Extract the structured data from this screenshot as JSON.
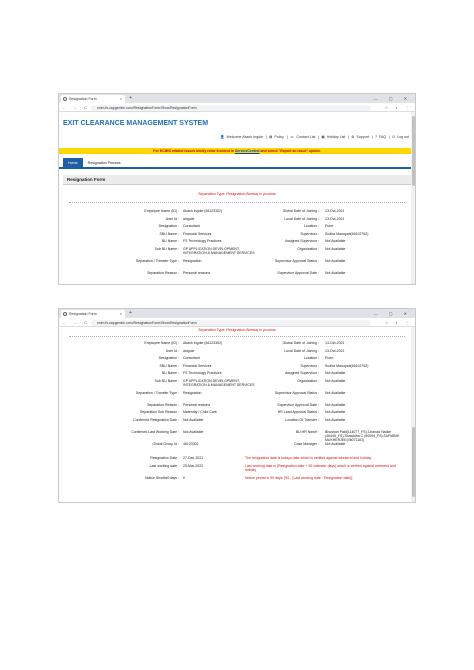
{
  "browser": {
    "tab_title": "Resignation Form",
    "tab_close": "×",
    "new_tab": "+",
    "window_controls": "— ▢ ✕",
    "nav_buttons": "← → C ⌂",
    "url": "ecim.fs.capgemini.com/ResignationForm/ShowResignationForm",
    "addr_icons": "☆ ◐ ⋮"
  },
  "app": {
    "title": "EXIT CLEARANCE MANAGEMENT SYSTEM",
    "welcome": "Welcome Akash Ingole",
    "policy": "Policy",
    "contact_list": "Contact List",
    "holiday_list": "Holiday List",
    "support": "Support",
    "faq": "FAQ",
    "logout": "Log out",
    "banner_pre": "For ECIMS related issues kindly raise incident in",
    "banner_link": "ServiceCentral",
    "banner_post": "and select \"Report an issue\" option.",
    "nav_home": "Home",
    "nav_process": "Resignation Process",
    "section_title": "Resignation Form",
    "separation_type": "Separation Type: Resignation Already in process"
  },
  "form1": [
    [
      "Employee Name (ID) :",
      "Akash Ingole (46123302)",
      "Global Date of Joining :",
      "13-Oct-2021"
    ],
    [
      "User Id :",
      "aingole",
      "Local Date of Joining :",
      "13-Oct-2021"
    ],
    [
      "Designation :",
      "Consultant",
      "Location :",
      "Pune"
    ],
    [
      "SBU Name :",
      "Financial Services",
      "Supervisor :",
      "Sudha Manupati(46102762)"
    ],
    [
      "BU Name :",
      "FS Technology Practices",
      "Assigned Supervisor :",
      "Not Available"
    ],
    [
      "Sub BU Name :",
      "GP APPLICATION DEVELOPMENT, INTEGRATION & MANAGEMENT SERVICES",
      "Organization :",
      "Not Available"
    ],
    [
      "Separation / Transfer Type :",
      "Resignation",
      "Supervisor Approval Status :",
      "Not Available"
    ],
    [
      "Separation Reason :",
      "Personal reasons",
      "Supervisor Approval Date :",
      "Not Available"
    ]
  ],
  "form2": [
    [
      "Employee Name (ID) :",
      "Akash Ingole (46123302)",
      "Global Date of Joining :",
      "13-Oct-2021"
    ],
    [
      "User Id :",
      "aingole",
      "Local Date of Joining :",
      "13-Oct-2021"
    ],
    [
      "Designation :",
      "Consultant",
      "Location :",
      "Pune"
    ],
    [
      "SBU Name :",
      "Financial Services",
      "Supervisor :",
      "Sudha Manupati(46102762)"
    ],
    [
      "BU Name :",
      "FS Technology Practices",
      "Assigned Supervisor :",
      "Not Available"
    ],
    [
      "Sub BU Name :",
      "GP APPLICATION DEVELOPMENT, INTEGRATION & MANAGEMENT SERVICES",
      "Organization :",
      "Not Available"
    ],
    [
      "Separation / Transfer Type :",
      "Resignation",
      "Supervisor Approval Status :",
      "Not Available"
    ],
    [
      "Separation Reason :",
      "Personal reasons",
      "Supervisor Approval Date :",
      "Not Available"
    ],
    [
      "Separation Sub Reason :",
      "Maternity / Child Care",
      "HR Lead Approval Status :",
      "Not Available"
    ],
    [
      "Confirmed Resignation Date :",
      "Not Available",
      "Location Of Transfer :",
      "Not Available"
    ],
    [
      "Confirmed Last Working Date :",
      "Not Available",
      "BU HR Name :",
      "Bhushan Patil(114077_FS),Chanda Hadke (46445_FS),Shraddha C (90094_FS),SURABHI MUKHERJEE(46071181)"
    ],
    [
      "Global Group Id :",
      "46123302",
      "Case Manager :",
      "Not Available"
    ]
  ],
  "dates": [
    [
      "Resignation Date :",
      "27-Dec-2021",
      "The resignation date is todays date which is verified against weekend and holiday"
    ],
    [
      "Last working date :",
      "25-Mar-2022",
      "Last working date is (Resignation date + 90 calender days) which is verified against weekend and holiday"
    ],
    [
      "Notice Shortfall days :",
      "0",
      "Notice period is 90 days. [90 - (Last working date - Resignation date)]"
    ]
  ]
}
